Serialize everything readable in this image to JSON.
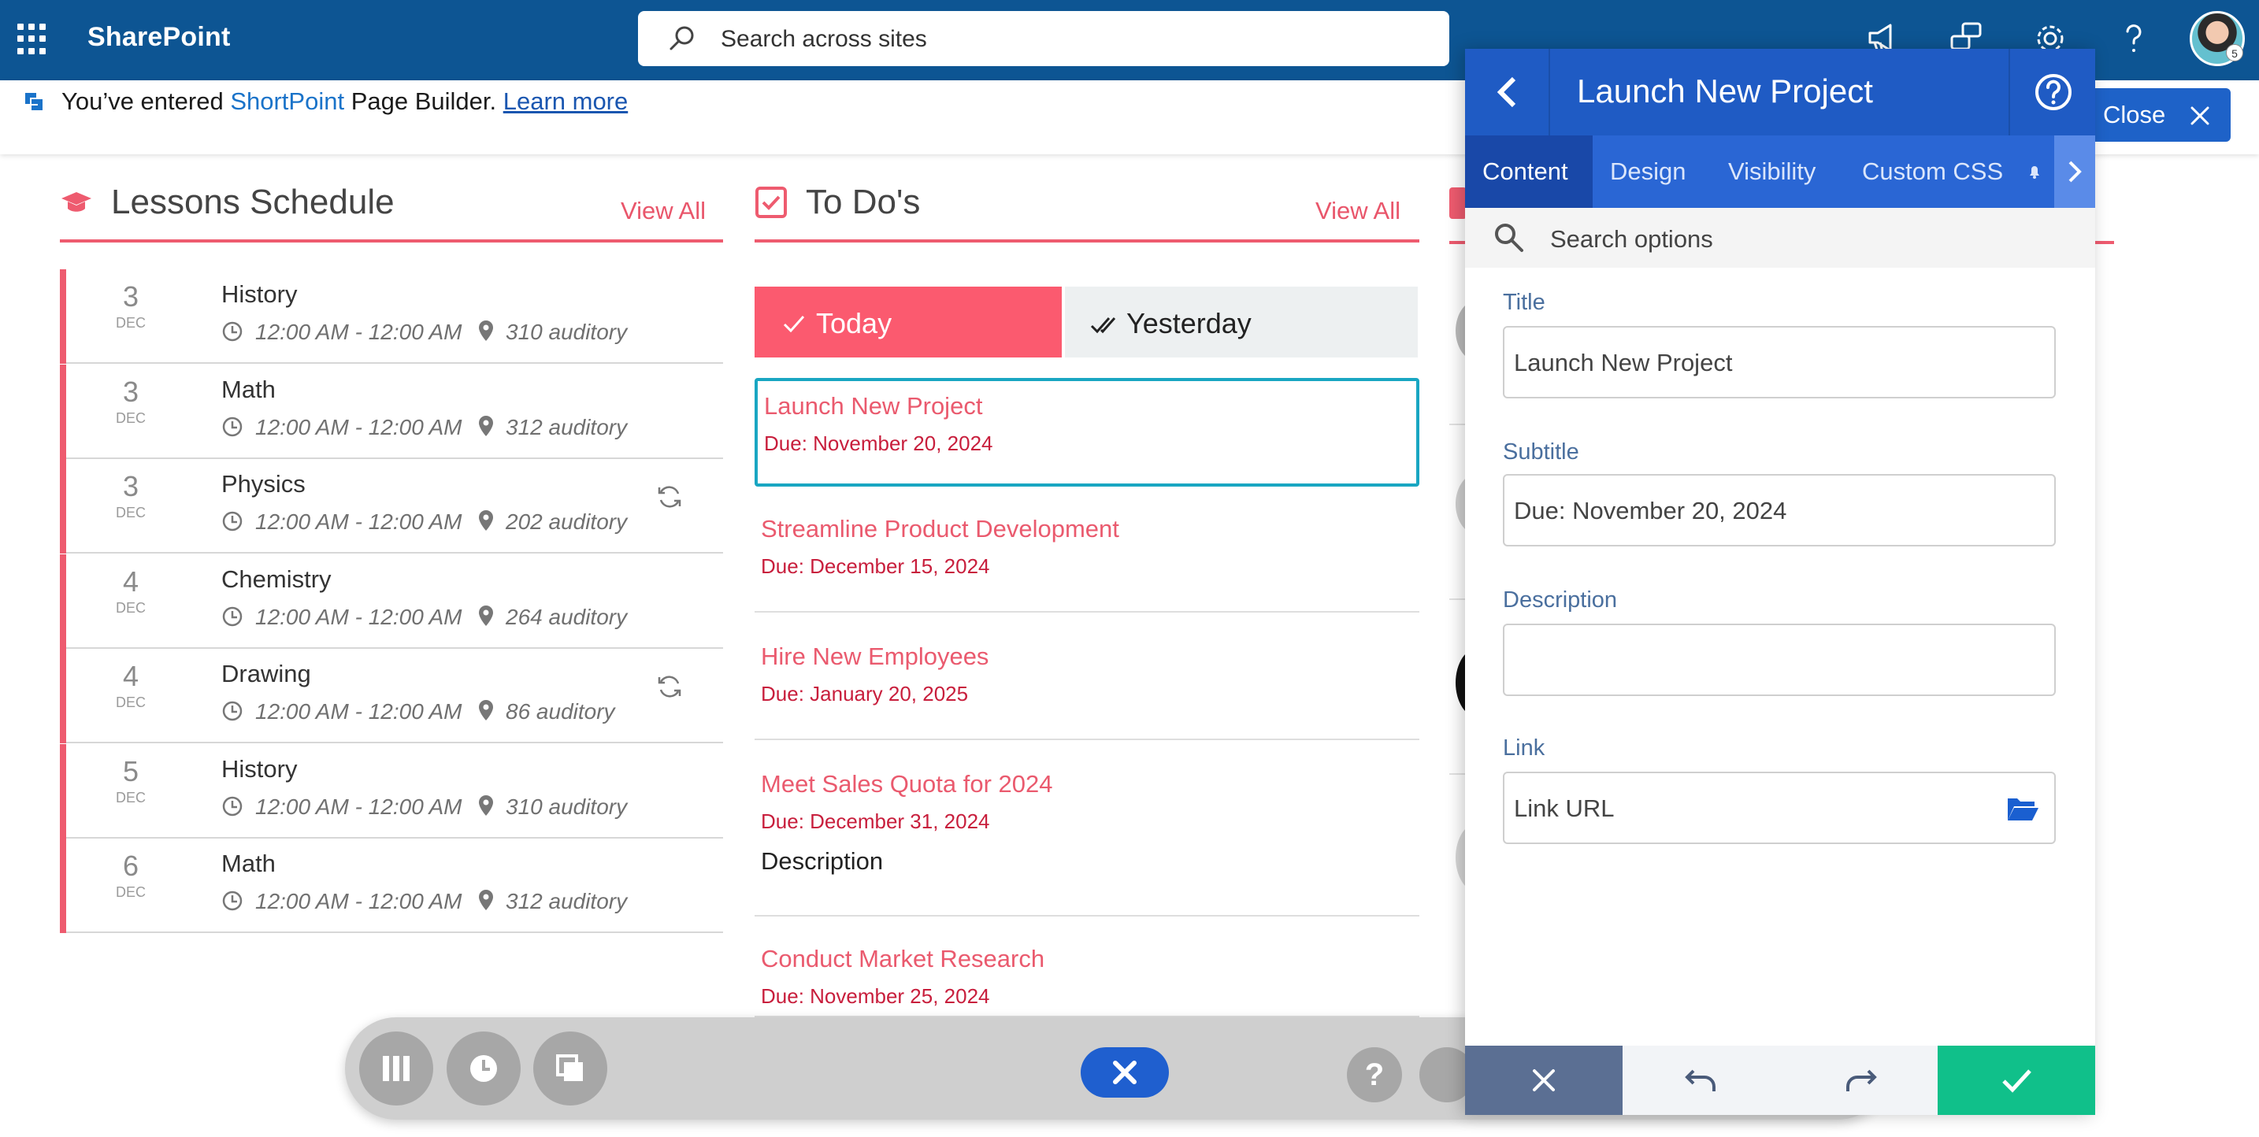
{
  "app": {
    "name": "SharePoint",
    "search_placeholder": "Search across sites",
    "avatar_badge": "5"
  },
  "notice": {
    "prefix": "You’ve entered ",
    "brand": "ShortPoint",
    "suffix": " Page Builder. ",
    "link": "Learn more",
    "close_label": "Close"
  },
  "lessons": {
    "title": "Lessons Schedule",
    "view_all": "View All",
    "items": [
      {
        "day": "3",
        "month": "DEC",
        "subject": "History",
        "time": "12:00 AM - 12:00 AM",
        "room": "310 auditory",
        "recurring": false
      },
      {
        "day": "3",
        "month": "DEC",
        "subject": "Math",
        "time": "12:00 AM - 12:00 AM",
        "room": "312 auditory",
        "recurring": false
      },
      {
        "day": "3",
        "month": "DEC",
        "subject": "Physics",
        "time": "12:00 AM - 12:00 AM",
        "room": "202 auditory",
        "recurring": true
      },
      {
        "day": "4",
        "month": "DEC",
        "subject": "Chemistry",
        "time": "12:00 AM - 12:00 AM",
        "room": "264 auditory",
        "recurring": false
      },
      {
        "day": "4",
        "month": "DEC",
        "subject": "Drawing",
        "time": "12:00 AM - 12:00 AM",
        "room": "86 auditory",
        "recurring": true
      },
      {
        "day": "5",
        "month": "DEC",
        "subject": "History",
        "time": "12:00 AM - 12:00 AM",
        "room": "310 auditory",
        "recurring": false
      },
      {
        "day": "6",
        "month": "DEC",
        "subject": "Math",
        "time": "12:00 AM - 12:00 AM",
        "room": "312 auditory",
        "recurring": false
      }
    ]
  },
  "todos": {
    "title": "To Do's",
    "view_all": "View All",
    "tab_today": "Today",
    "tab_yesterday": "Yesterday",
    "items": [
      {
        "title": "Launch New Project",
        "due": "Due: November 20, 2024",
        "desc": ""
      },
      {
        "title": "Streamline Product Development",
        "due": "Due: December 15, 2024",
        "desc": ""
      },
      {
        "title": "Hire New Employees",
        "due": "Due: January 20, 2025",
        "desc": ""
      },
      {
        "title": "Meet Sales Quota for 2024",
        "due": "Due: December 31, 2024",
        "desc": "Description"
      },
      {
        "title": "Conduct Market Research",
        "due": "Due: November 25, 2024",
        "desc": ""
      }
    ]
  },
  "panel": {
    "title": "Launch New Project",
    "tabs": [
      "Content",
      "Design",
      "Visibility",
      "Custom CSS"
    ],
    "search_placeholder": "Search options",
    "fields": {
      "title_label": "Title",
      "title_value": "Launch New Project",
      "subtitle_label": "Subtitle",
      "subtitle_value": "Due: November 20, 2024",
      "description_label": "Description",
      "description_value": "",
      "link_label": "Link",
      "link_placeholder": "Link URL"
    }
  },
  "toolbar": {
    "help": "?"
  },
  "colors": {
    "brand_bar": "#0d5593",
    "accent": "#ee5b6f",
    "panel_blue": "#1f5bc4",
    "confirm": "#10c08a"
  }
}
